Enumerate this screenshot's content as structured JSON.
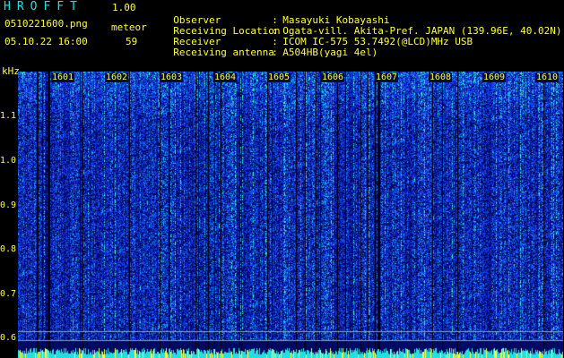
{
  "header": {
    "app_title": "HROFFT",
    "version": "1.00",
    "filename": "0510221600.png",
    "datetime": "05.10.22 16:00",
    "meteor_label": "meteor",
    "meteor_count": "59"
  },
  "station": {
    "observer_label": "Observer",
    "observer": "Masayuki Kobayashi",
    "location_label": "Receiving Location",
    "location": "Ogata-vill. Akita-Pref. JAPAN (139.96E, 40.02N)",
    "receiver_label": "Receiver",
    "receiver": "ICOM IC-575 53.7492(@LCD)MHz USB",
    "antenna_label": "Receiving antenna",
    "antenna": "A504HB(yagi 4el)",
    "separator": ":"
  },
  "axis": {
    "unit": "kHz",
    "y_ticks": [
      "1.1",
      "1.0",
      "0.9",
      "0.8",
      "0.7",
      "0.6"
    ],
    "minute_labels": [
      "1601",
      "1602",
      "1603",
      "1604",
      "1605",
      "1606",
      "1607",
      "1608",
      "1609",
      "1610"
    ]
  },
  "colors": {
    "text": "#ffff33",
    "title": "#22e0e0",
    "background": "#000000",
    "noise_low": "#000b44",
    "noise_mid": "#1a3cff",
    "noise_high": "#33ffcc"
  }
}
